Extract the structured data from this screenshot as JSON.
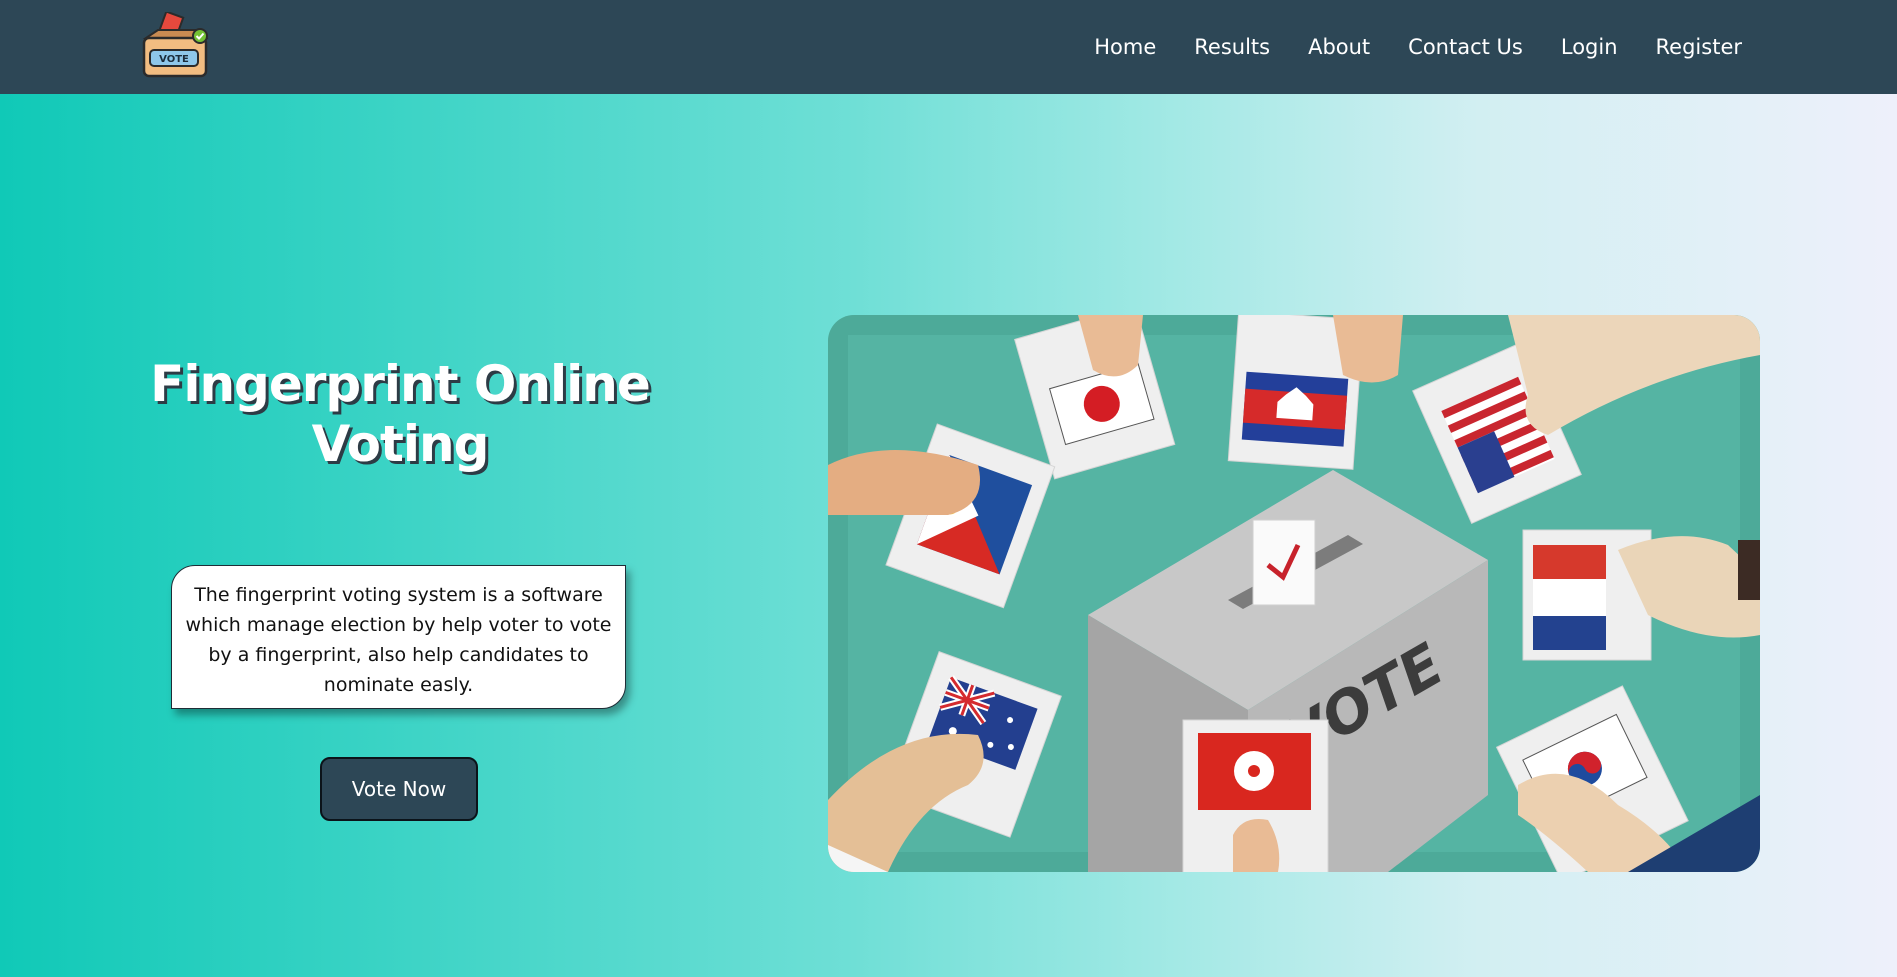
{
  "nav": {
    "logo_text": "VOTE",
    "links": [
      "Home",
      "Results",
      "About",
      "Contact Us",
      "Login",
      "Register"
    ]
  },
  "hero": {
    "title": "Fingerprint Online Voting",
    "description": "The fingerprint voting system is a software which manage election by help voter to vote by a fingerprint, also help candidates to nominate easly.",
    "cta_label": "Vote Now",
    "illustration_text": "VOTE"
  },
  "colors": {
    "navbar": "#2d4756",
    "button": "#2d4756",
    "gradient_start": "#10c9b7",
    "gradient_end": "#eef0fb",
    "illustration_bg": "#55b4a3"
  }
}
